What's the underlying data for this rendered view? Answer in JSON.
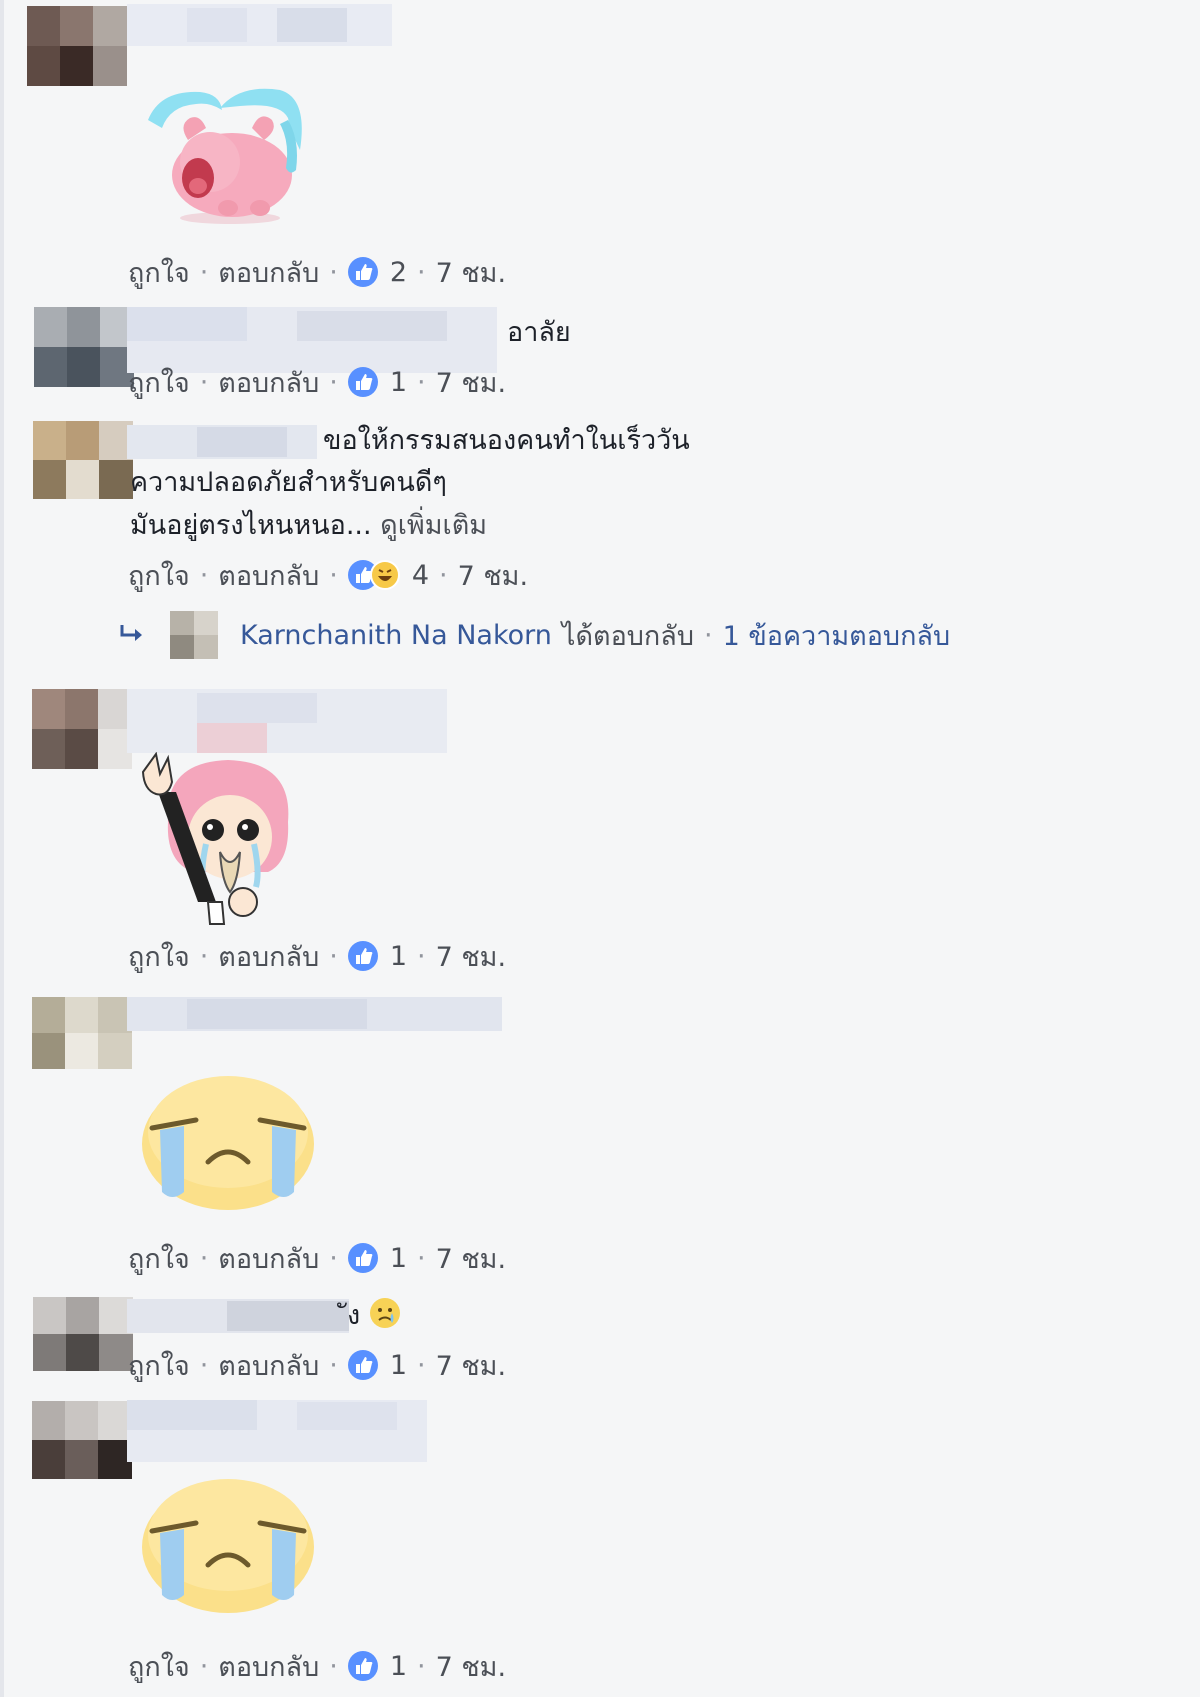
{
  "comments": [
    {
      "type": "sticker",
      "sticker": "crying-pig-sticker",
      "actions": {
        "like": "ถูกใจ",
        "reply": "ตอบกลับ",
        "count": "2",
        "time": "7 ชม."
      }
    },
    {
      "type": "text",
      "text": "อาลัย",
      "actions": {
        "like": "ถูกใจ",
        "reply": "ตอบกลับ",
        "count": "1",
        "time": "7 ชม."
      }
    },
    {
      "type": "text",
      "line1": "ขอให้กรรมสนองคนทำในเร็ววัน",
      "line2": "ความปลอดภัยสำหรับคนดีๆ",
      "line3": "มันอยู่ตรงไหนหนอ...",
      "see_more": "ดูเพิ่มเติม",
      "actions": {
        "like": "ถูกใจ",
        "reply": "ตอบกลับ",
        "count": "4",
        "time": "7 ชม."
      },
      "reply_summary": {
        "name": "Karnchanith Na Nakorn",
        "replied": "ได้ตอบกลับ",
        "count_text": "1 ข้อความตอบกลับ"
      }
    },
    {
      "type": "sticker",
      "sticker": "crying-pink-hair-girl-sticker",
      "actions": {
        "like": "ถูกใจ",
        "reply": "ตอบกลับ",
        "count": "1",
        "time": "7 ชม."
      }
    },
    {
      "type": "sticker",
      "sticker": "crying-face-sticker",
      "actions": {
        "like": "ถูกใจ",
        "reply": "ตอบกลับ",
        "count": "1",
        "time": "7 ชม."
      }
    },
    {
      "type": "text",
      "text": "ัง",
      "emoji": "sad-emoji",
      "actions": {
        "like": "ถูกใจ",
        "reply": "ตอบกลับ",
        "count": "1",
        "time": "7 ชม."
      }
    },
    {
      "type": "sticker",
      "sticker": "crying-face-sticker",
      "actions": {
        "like": "ถูกใจ",
        "reply": "ตอบกลับ",
        "count": "1",
        "time": "7 ชม."
      }
    }
  ],
  "icons": {
    "like": "thumbs-up-icon",
    "haha": "haha-reaction-icon",
    "reply_arrow": "reply-arrow-icon"
  },
  "colors": {
    "like_blue": "#5890ff",
    "link": "#365899",
    "meta": "#4b4f56",
    "background": "#f5f6f7"
  }
}
